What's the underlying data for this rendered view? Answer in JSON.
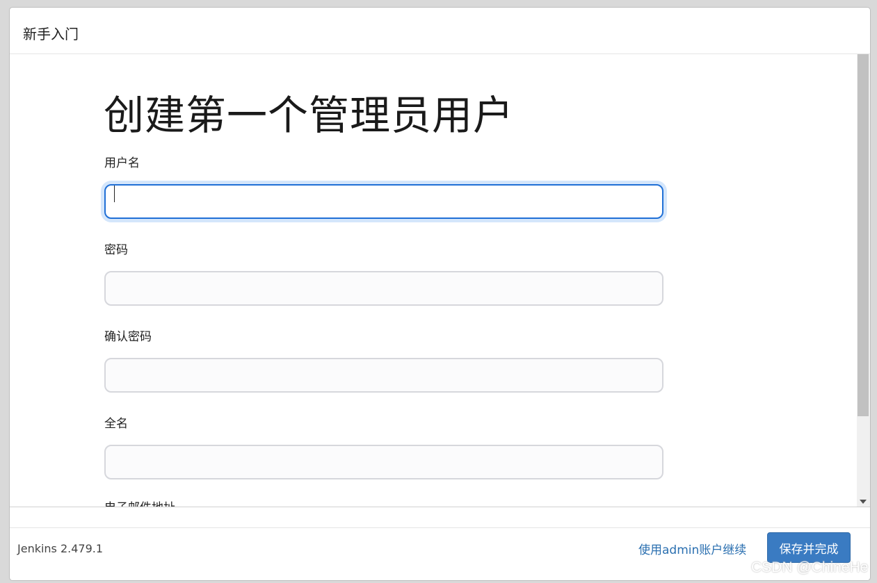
{
  "dialog": {
    "title": "新手入门"
  },
  "page": {
    "heading": "创建第一个管理员用户"
  },
  "form": {
    "username_label": "用户名",
    "username_value": "",
    "password_label": "密码",
    "password_value": "",
    "confirm_password_label": "确认密码",
    "confirm_password_value": "",
    "fullname_label": "全名",
    "fullname_value": "",
    "email_label": "电子邮件地址"
  },
  "footer": {
    "version": "Jenkins 2.479.1",
    "continue_link": "使用admin账户继续",
    "save_button": "保存并完成"
  },
  "watermark": "CSDN @ChineHe",
  "colors": {
    "primary_button": "#3a7bc2",
    "link": "#2a6fb0",
    "focus_border": "#1f6fd6"
  }
}
